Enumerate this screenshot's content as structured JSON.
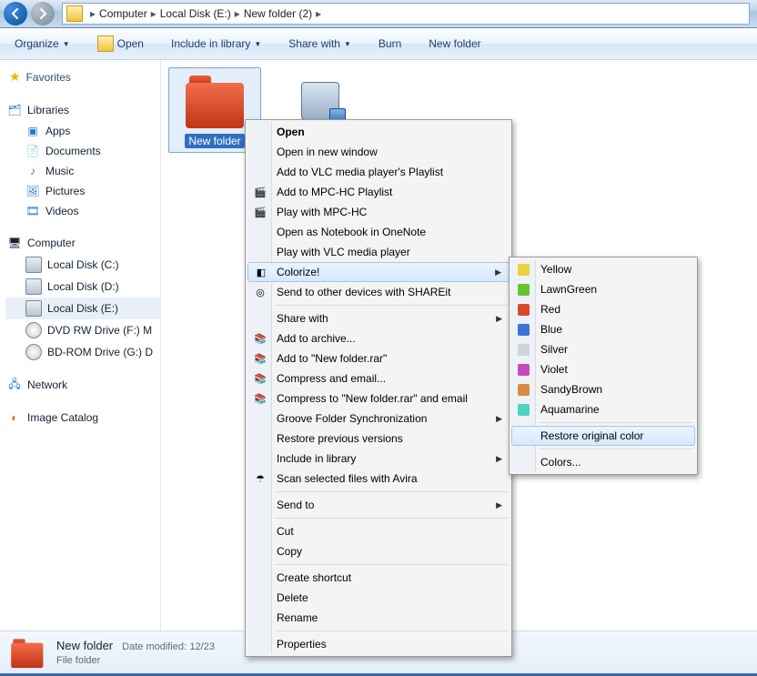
{
  "address": {
    "crumbs": [
      "Computer",
      "Local Disk (E:)",
      "New folder (2)"
    ]
  },
  "toolbar": {
    "organize": "Organize",
    "open": "Open",
    "include": "Include in library",
    "share": "Share with",
    "burn": "Burn",
    "newfolder": "New folder"
  },
  "sidebar": {
    "favorites": "Favorites",
    "libraries_hdr": "Libraries",
    "libraries": [
      "Apps",
      "Documents",
      "Music",
      "Pictures",
      "Videos"
    ],
    "computer_hdr": "Computer",
    "drives": [
      {
        "label": "Local Disk (C:)",
        "kind": "drive"
      },
      {
        "label": "Local Disk (D:)",
        "kind": "drive"
      },
      {
        "label": "Local Disk (E:)",
        "kind": "drive",
        "selected": true
      },
      {
        "label": "DVD RW Drive (F:)  M",
        "kind": "cd"
      },
      {
        "label": "BD-ROM Drive (G:) D",
        "kind": "cd"
      }
    ],
    "network": "Network",
    "image_catalog": "Image Catalog"
  },
  "items": {
    "selected_folder_label": "New folder"
  },
  "context_menu": {
    "items": [
      {
        "label": "Open",
        "bold": true
      },
      {
        "label": "Open in new window"
      },
      {
        "label": "Add to VLC media player's Playlist"
      },
      {
        "label": "Add to MPC-HC Playlist",
        "icon": "mpc"
      },
      {
        "label": "Play with MPC-HC",
        "icon": "mpc"
      },
      {
        "label": "Open as Notebook in OneNote"
      },
      {
        "label": "Play with VLC media player"
      },
      {
        "label": "Colorize!",
        "icon": "colorize",
        "submenu": true,
        "highlight": true
      },
      {
        "label": "Send to other devices with SHAREit",
        "icon": "shareit"
      },
      {
        "sep": true
      },
      {
        "label": "Share with",
        "submenu": true
      },
      {
        "label": "Add to archive...",
        "icon": "rar"
      },
      {
        "label": "Add to \"New folder.rar\"",
        "icon": "rar"
      },
      {
        "label": "Compress and email...",
        "icon": "rar"
      },
      {
        "label": "Compress to \"New folder.rar\" and email",
        "icon": "rar"
      },
      {
        "label": "Groove Folder Synchronization",
        "submenu": true
      },
      {
        "label": "Restore previous versions"
      },
      {
        "label": "Include in library",
        "submenu": true
      },
      {
        "label": "Scan selected files with Avira",
        "icon": "avira"
      },
      {
        "sep": true
      },
      {
        "label": "Send to",
        "submenu": true
      },
      {
        "sep": true
      },
      {
        "label": "Cut"
      },
      {
        "label": "Copy"
      },
      {
        "sep": true
      },
      {
        "label": "Create shortcut"
      },
      {
        "label": "Delete"
      },
      {
        "label": "Rename"
      },
      {
        "sep": true
      },
      {
        "label": "Properties"
      }
    ]
  },
  "colorize_submenu": {
    "colors": [
      {
        "label": "Yellow",
        "hex": "#e9d23b"
      },
      {
        "label": "LawnGreen",
        "hex": "#62c62d"
      },
      {
        "label": "Red",
        "hex": "#d84a2b"
      },
      {
        "label": "Blue",
        "hex": "#3c73d6"
      },
      {
        "label": "Silver",
        "hex": "#cfd4da"
      },
      {
        "label": "Violet",
        "hex": "#c24bc0"
      },
      {
        "label": "SandyBrown",
        "hex": "#d98b45"
      },
      {
        "label": "Aquamarine",
        "hex": "#4fd2c0"
      }
    ],
    "restore": "Restore original color",
    "more_colors": "Colors..."
  },
  "details": {
    "name": "New folder",
    "date_label": "Date modified:",
    "date_value": "12/23",
    "type": "File folder"
  }
}
